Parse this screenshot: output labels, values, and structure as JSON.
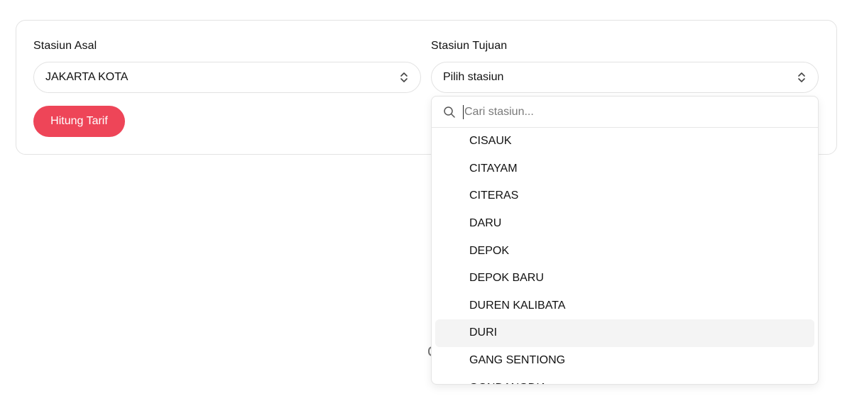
{
  "form": {
    "origin_label": "Stasiun Asal",
    "origin_value": "JAKARTA KOTA",
    "destination_label": "Stasiun Tujuan",
    "destination_value": "Pilih stasiun",
    "submit_label": "Hitung Tarif"
  },
  "dropdown": {
    "search_placeholder": "Cari stasiun...",
    "options": [
      "CISAUK",
      "CITAYAM",
      "CITERAS",
      "DARU",
      "DEPOK",
      "DEPOK BARU",
      "DUREN KALIBATA",
      "DURI",
      "GANG SENTIONG",
      "GONDANGDIA"
    ],
    "highlighted": "DURI"
  },
  "colors": {
    "accent": "#ee4558",
    "border": "#e3e3e3",
    "highlight": "#f4f4f4"
  },
  "icons": [
    "chevron-up-down-icon",
    "search-icon"
  ]
}
